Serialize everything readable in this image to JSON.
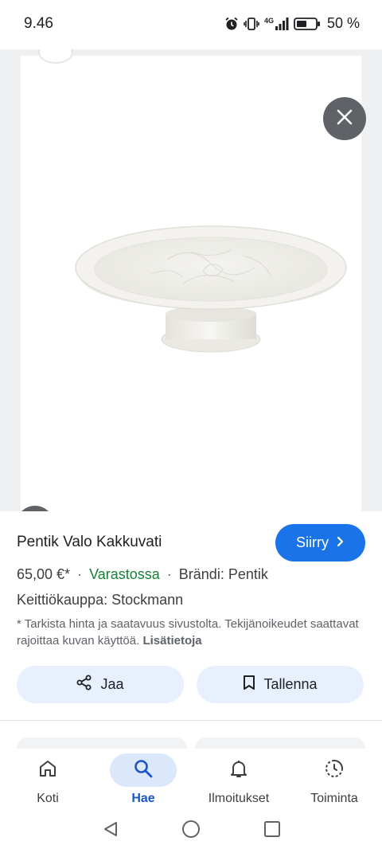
{
  "status_bar": {
    "time": "9.46",
    "network": "4G",
    "battery": "50 %"
  },
  "viewer": {
    "close_icon": "close-icon",
    "lens_icon": "lens-icon"
  },
  "product": {
    "title": "Pentik Valo Kakkuvati",
    "price": "65,00 €*",
    "stock": "Varastossa",
    "brand": "Brändi: Pentik",
    "store": "Keittiökauppa: Stockmann",
    "disclaimer": "* Tarkista hinta ja saatavuus sivustolta. Tekijänoikeudet saattavat rajoittaa kuvan käyttöä.",
    "more_link": "Lisätietoja"
  },
  "actions": {
    "visit_label": "Siirry",
    "share_label": "Jaa",
    "save_label": "Tallenna"
  },
  "bottom_nav": {
    "items": [
      {
        "label": "Koti",
        "icon": "home-icon",
        "active": false
      },
      {
        "label": "Hae",
        "icon": "search-icon",
        "active": true
      },
      {
        "label": "Ilmoitukset",
        "icon": "bell-icon",
        "active": false
      },
      {
        "label": "Toiminta",
        "icon": "activity-icon",
        "active": false
      }
    ]
  },
  "colors": {
    "accent": "#1a73e8",
    "stock_green": "#188038",
    "pill_bg": "#e8f0fe"
  }
}
